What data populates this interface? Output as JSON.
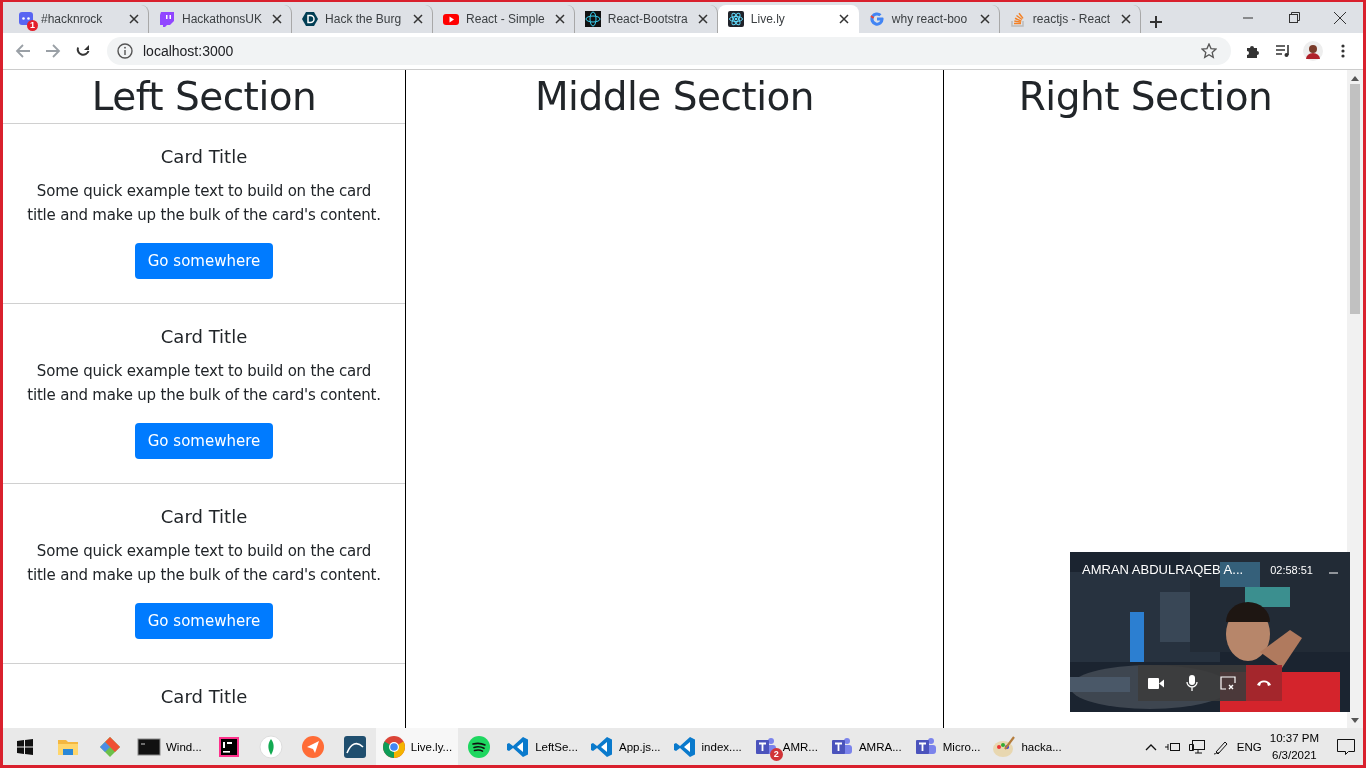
{
  "browser": {
    "tabs": [
      {
        "title": "#hacknrock",
        "kind": "chat",
        "badge": "1",
        "selected": false
      },
      {
        "title": "HackathonsUK",
        "kind": "stream",
        "selected": false
      },
      {
        "title": "Hack the Burg",
        "kind": "hexagon",
        "selected": false
      },
      {
        "title": "React - Simple",
        "kind": "video",
        "selected": false
      },
      {
        "title": "React-Bootstra",
        "kind": "docs",
        "selected": false
      },
      {
        "title": "Live.ly",
        "kind": "atom",
        "selected": true
      },
      {
        "title": "why react-boo",
        "kind": "search",
        "selected": false
      },
      {
        "title": "reactjs - React",
        "kind": "qa",
        "selected": false
      }
    ],
    "address": "localhost:3000"
  },
  "page": {
    "sections": [
      {
        "heading": "Left Section",
        "cards": [
          {
            "title": "Card Title",
            "text": "Some quick example text to build on the card title and make up the bulk of the card's content.",
            "button": "Go somewhere"
          },
          {
            "title": "Card Title",
            "text": "Some quick example text to build on the card title and make up the bulk of the card's content.",
            "button": "Go somewhere"
          },
          {
            "title": "Card Title",
            "text": "Some quick example text to build on the card title and make up the bulk of the card's content.",
            "button": "Go somewhere"
          },
          {
            "title": "Card Title"
          }
        ]
      },
      {
        "heading": "Middle Section"
      },
      {
        "heading": "Right Section"
      }
    ]
  },
  "call": {
    "name": "AMRAN ABDULRAQEB A...",
    "timer": "02:58:51"
  },
  "taskbar": {
    "apps": [
      {
        "kind": "folder",
        "selected": false
      },
      {
        "kind": "diamond",
        "selected": false
      },
      {
        "kind": "terminal",
        "label": "Wind...",
        "selected": false
      },
      {
        "kind": "ide",
        "selected": false
      },
      {
        "kind": "leaf",
        "selected": false
      },
      {
        "kind": "plane",
        "selected": false
      },
      {
        "kind": "database",
        "selected": false
      },
      {
        "kind": "browser",
        "label": "Live.ly...",
        "selected": true
      },
      {
        "kind": "music",
        "selected": false
      },
      {
        "kind": "editor",
        "label": "LeftSe...",
        "selected": false
      },
      {
        "kind": "editor",
        "label": "App.js...",
        "selected": false
      },
      {
        "kind": "editor",
        "label": "index....",
        "selected": false
      },
      {
        "kind": "teams",
        "label": "AMR...",
        "badge": "2",
        "selected": false
      },
      {
        "kind": "teams",
        "label": "AMRA...",
        "selected": false
      },
      {
        "kind": "teams",
        "label": "Micro...",
        "selected": false
      },
      {
        "kind": "paint",
        "label": "hacka...",
        "selected": false
      }
    ],
    "language": "ENG",
    "time": "10:37 PM",
    "date": "6/3/2021"
  }
}
